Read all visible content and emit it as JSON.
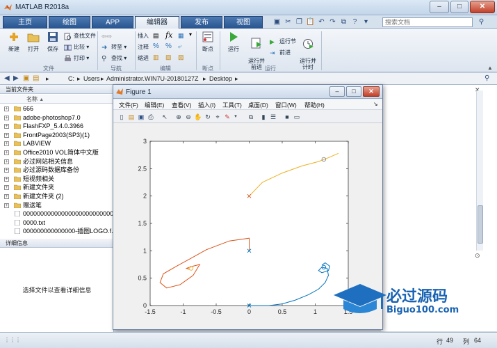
{
  "window": {
    "title": "MATLAB R2018a"
  },
  "tabs": [
    {
      "label": "主页",
      "active": false
    },
    {
      "label": "绘图",
      "active": false
    },
    {
      "label": "APP",
      "active": false
    },
    {
      "label": "编辑器",
      "active": true
    },
    {
      "label": "发布",
      "active": false
    },
    {
      "label": "视图",
      "active": false
    }
  ],
  "search": {
    "placeholder": "搜索文档"
  },
  "ribbon": {
    "file": {
      "new": "新建",
      "open": "打开",
      "save": "保存",
      "find_files": "查找文件",
      "compare": "比较",
      "print": "打印",
      "section": "文件"
    },
    "navigate": {
      "goto": "转至",
      "find": "查找",
      "section": "导航"
    },
    "edit": {
      "insert": "插入",
      "comment": "注释",
      "indent": "缩进",
      "section": "编辑"
    },
    "breakpoints": {
      "bp": "断点",
      "section": "断点"
    },
    "run": {
      "run": "运行",
      "run_advance": "运行并\n前进",
      "run_section": "运行节",
      "advance": "前进",
      "run_time": "运行并\n计时",
      "section": "运行"
    }
  },
  "address": {
    "path": [
      "C:",
      "Users",
      "Administrator.WIN7U-20180127Z",
      "Desktop"
    ]
  },
  "current_folder": {
    "title": "当前文件夹",
    "column_name": "名称",
    "items": [
      {
        "name": "666",
        "type": "folder"
      },
      {
        "name": "adobe-photoshop7.0",
        "type": "folder"
      },
      {
        "name": "FlashFXP_5.4.0.3966",
        "type": "folder"
      },
      {
        "name": "FrontPage2003(SP3)(1)",
        "type": "folder"
      },
      {
        "name": "LABVIEW",
        "type": "folder"
      },
      {
        "name": "Office2010 VOL简体中文版",
        "type": "folder"
      },
      {
        "name": "必过网站相关信息",
        "type": "folder"
      },
      {
        "name": "必过源码数据库备份",
        "type": "folder"
      },
      {
        "name": "短视频相关",
        "type": "folder"
      },
      {
        "name": "新建文件夹",
        "type": "folder"
      },
      {
        "name": "新建文件夹 (2)",
        "type": "folder"
      },
      {
        "name": "赠送笔",
        "type": "folder"
      },
      {
        "name": "00000000000000000000000000...",
        "type": "file"
      },
      {
        "name": "0000.txt",
        "type": "file"
      },
      {
        "name": "000000000000000-插图LOGO.f...",
        "type": "file"
      }
    ]
  },
  "details": {
    "title": "详细信息",
    "message": "选择文件以查看详细信息"
  },
  "figure": {
    "title": "Figure 1",
    "menu": [
      "文件(F)",
      "编辑(E)",
      "查看(V)",
      "插入(I)",
      "工具(T)",
      "桌面(D)",
      "窗口(W)",
      "帮助(H)"
    ]
  },
  "chart_data": {
    "type": "line",
    "xlim": [
      -1.5,
      1.5
    ],
    "ylim": [
      0,
      3
    ],
    "xticks": [
      "-1.5",
      "-1",
      "-0.5",
      "0",
      "0.5",
      "1",
      "1.5"
    ],
    "yticks": [
      "0",
      "0.5",
      "1",
      "1.5",
      "2",
      "2.5",
      "3"
    ],
    "grid": false,
    "series": [
      {
        "color": "#0072bd",
        "x": [
          0,
          0.3,
          0.5,
          0.7,
          0.9,
          1.05,
          1.15,
          1.2,
          1.18,
          1.1,
          1.05,
          1.1,
          1.2,
          1.22,
          1.15,
          1.1
        ],
        "y": [
          0,
          0.0,
          0.03,
          0.1,
          0.2,
          0.3,
          0.42,
          0.55,
          0.68,
          0.7,
          0.64,
          0.6,
          0.64,
          0.72,
          0.78,
          0.74
        ]
      },
      {
        "color": "#d95319",
        "x": [
          0,
          0,
          -0.3,
          -0.65,
          -0.9,
          -1.1,
          -1.3,
          -1.35,
          -1.25,
          -1.05,
          -0.85,
          -0.75,
          -0.85,
          -0.95,
          -0.9
        ],
        "y": [
          1,
          1.23,
          1.18,
          1.02,
          0.85,
          0.72,
          0.58,
          0.42,
          0.32,
          0.38,
          0.55,
          0.75,
          0.72,
          0.68,
          0.66
        ]
      },
      {
        "color": "#edb120",
        "x": [
          0,
          0.2,
          0.5,
          0.8,
          1.05,
          1.2,
          1.35
        ],
        "y": [
          2,
          2.25,
          2.42,
          2.55,
          2.63,
          2.7,
          2.78
        ]
      }
    ],
    "markers": [
      {
        "x": 0,
        "y": 0,
        "symbol": "x",
        "color": "#0072bd"
      },
      {
        "x": 0,
        "y": 1,
        "symbol": "x",
        "color": "#0072bd"
      },
      {
        "x": 0,
        "y": 2,
        "symbol": "x",
        "color": "#d95319"
      },
      {
        "x": 1.13,
        "y": 0.7,
        "symbol": "o",
        "color": "#0072bd"
      },
      {
        "x": -0.88,
        "y": 0.68,
        "symbol": "o",
        "color": "#edb120"
      },
      {
        "x": 1.13,
        "y": 2.67,
        "symbol": "o",
        "color": "#888888"
      }
    ]
  },
  "status": {
    "row_label": "行",
    "row": "49",
    "col_label": "列",
    "col": "64"
  },
  "watermark": {
    "main": "必过源码",
    "sub": "Biguo100.com"
  }
}
